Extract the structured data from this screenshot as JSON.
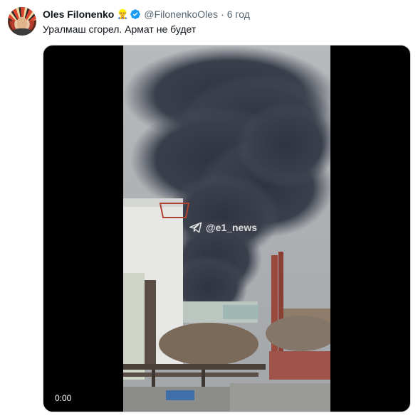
{
  "author": {
    "display_name": "Oles Filonenko",
    "emoji": "👷‍♂️",
    "handle": "@FilonenkoOles",
    "separator": "·",
    "time": "6 год"
  },
  "tweet": {
    "text": "Уралмаш сгорел. Армат не будет"
  },
  "media": {
    "timestamp": "0:00",
    "watermark": "@e1_news"
  },
  "colors": {
    "verified": "#1d9bf0",
    "secondary_text": "#536471",
    "primary_text": "#0f1419"
  },
  "icons": {
    "verified": "verified-badge-icon",
    "watermark": "telegram-icon"
  }
}
